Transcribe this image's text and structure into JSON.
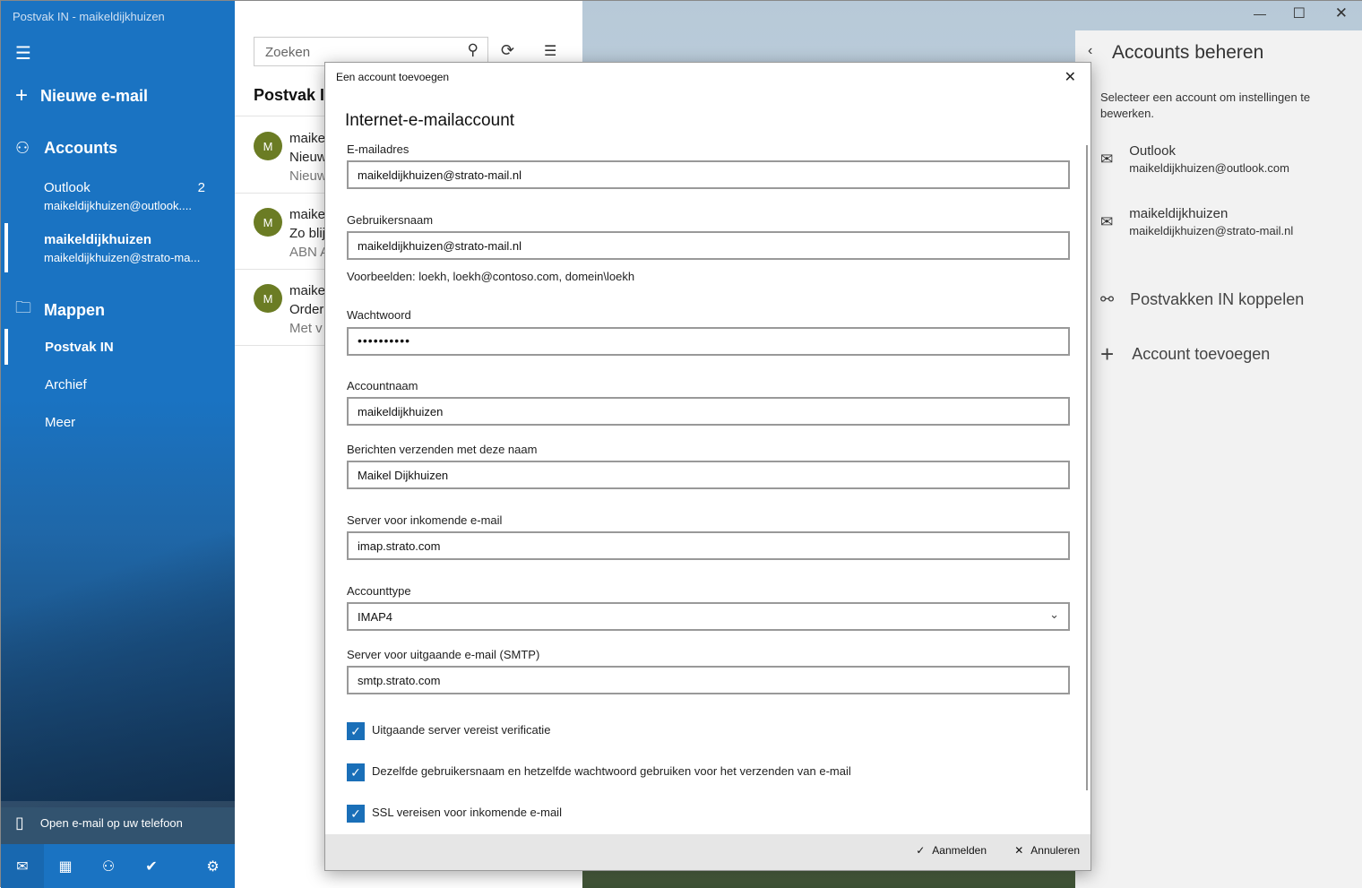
{
  "window": {
    "title": "Postvak IN - maikeldijkhuizen"
  },
  "sidebar": {
    "new_mail": "Nieuwe e-mail",
    "accounts_heading": "Accounts",
    "accounts": [
      {
        "name": "Outlook",
        "email": "maikeldijkhuizen@outlook....",
        "count": "2"
      },
      {
        "name": "maikeldijkhuizen",
        "email": "maikeldijkhuizen@strato-ma..."
      }
    ],
    "folders_heading": "Mappen",
    "folders": [
      "Postvak IN",
      "Archief",
      "Meer"
    ],
    "phone_link": "Open e-mail op uw telefoon",
    "bottom_icons": [
      "mail-icon",
      "calendar-icon",
      "people-icon",
      "todo-icon",
      "settings-icon"
    ]
  },
  "list": {
    "search_placeholder": "Zoeken",
    "title": "Postvak IN",
    "messages": [
      {
        "avatar": "M",
        "from": "maike",
        "subject": "Nieuw",
        "preview": "Nieuw"
      },
      {
        "avatar": "M",
        "from": "maike",
        "subject": "Zo blij",
        "preview": "ABN A"
      },
      {
        "avatar": "M",
        "from": "maike",
        "subject": "Order",
        "preview": "Met v"
      }
    ]
  },
  "right_panel": {
    "title": "Accounts beheren",
    "description": "Selecteer een account om instellingen te bewerken.",
    "accounts": [
      {
        "name": "Outlook",
        "email": "maikeldijkhuizen@outlook.com"
      },
      {
        "name": "maikeldijkhuizen",
        "email": "maikeldijkhuizen@strato-mail.nl"
      }
    ],
    "link_inboxes": "Postvakken IN koppelen",
    "add_account": "Account toevoegen"
  },
  "dialog": {
    "window_title": "Een account toevoegen",
    "heading": "Internet-e-mailaccount",
    "fields": {
      "email_label": "E-mailadres",
      "email": "maikeldijkhuizen@strato-mail.nl",
      "username_label": "Gebruikersnaam",
      "username": "maikeldijkhuizen@strato-mail.nl",
      "examples": "Voorbeelden: loekh, loekh@contoso.com, domein\\loekh",
      "password_label": "Wachtwoord",
      "password": "••••••••••",
      "accountname_label": "Accountnaam",
      "accountname": "maikeldijkhuizen",
      "sendername_label": "Berichten verzenden met deze naam",
      "sendername": "Maikel Dijkhuizen",
      "incoming_label": "Server voor inkomende e-mail",
      "incoming": "imap.strato.com",
      "type_label": "Accounttype",
      "type": "IMAP4",
      "outgoing_label": "Server voor uitgaande e-mail (SMTP)",
      "outgoing": "smtp.strato.com"
    },
    "checkboxes": [
      {
        "label": "Uitgaande server vereist verificatie",
        "checked": true
      },
      {
        "label": "Dezelfde gebruikersnaam en hetzelfde wachtwoord gebruiken voor het verzenden van e-mail",
        "checked": true
      },
      {
        "label": "SSL vereisen voor inkomende e-mail",
        "checked": true
      }
    ],
    "sign_in": "Aanmelden",
    "cancel": "Annuleren"
  },
  "colors": {
    "accent": "#1a73c2",
    "avatar": "#6b7c24",
    "checkbox": "#1a6fb8"
  }
}
